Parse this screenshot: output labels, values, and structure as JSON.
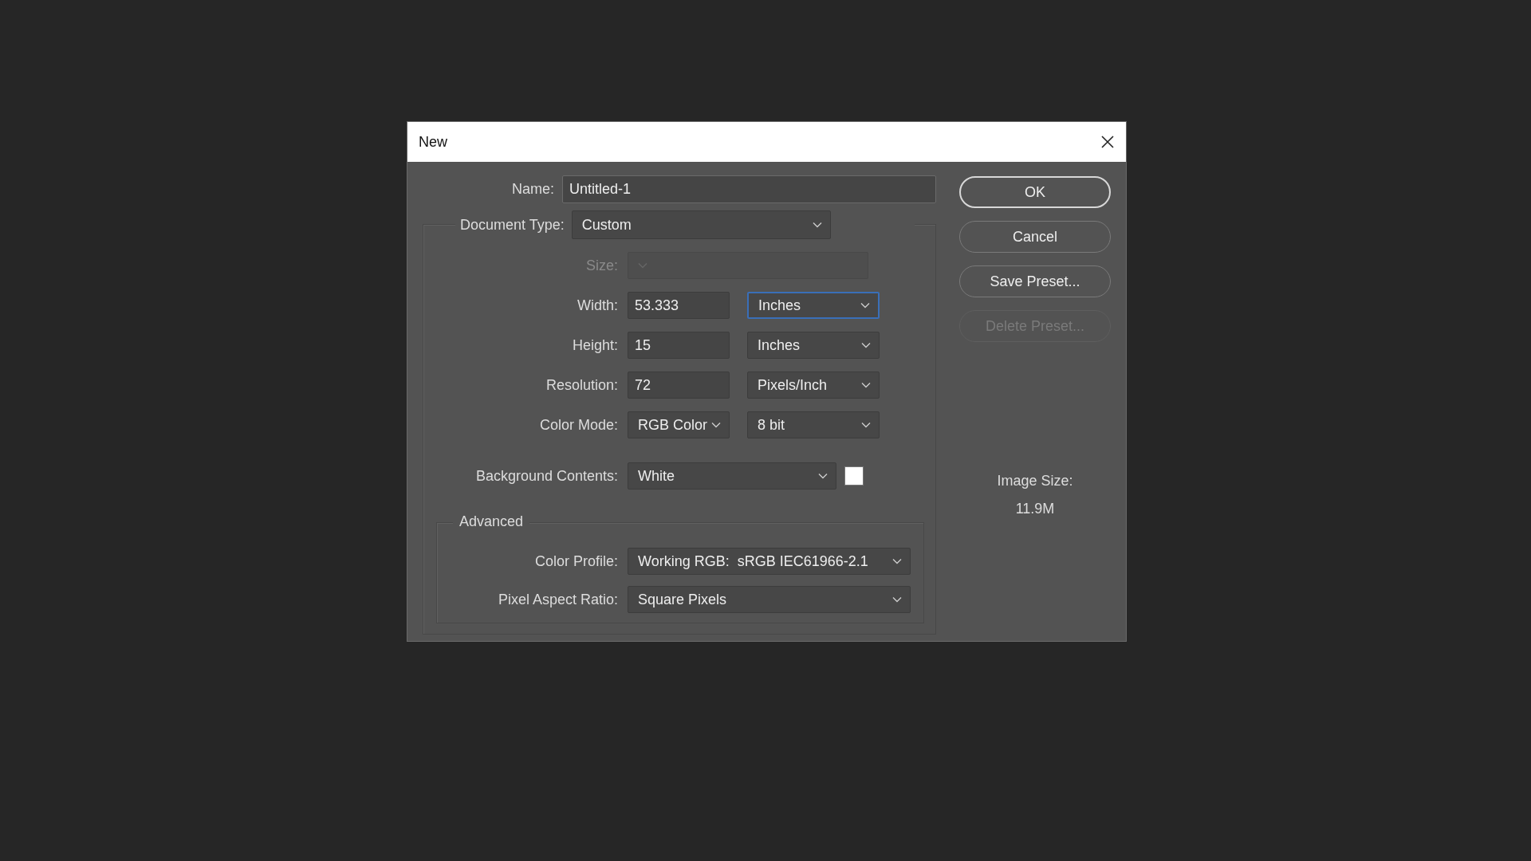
{
  "window": {
    "title": "New"
  },
  "name": {
    "label": "Name:",
    "value": "Untitled-1"
  },
  "document_type": {
    "label": "Document Type:",
    "value": "Custom"
  },
  "fields": [
    {
      "kind": "select",
      "label": "Size:",
      "disabled": true,
      "focused": false
    },
    {
      "kind": "number_unit",
      "label": "Width:",
      "value": "53.333",
      "unit": "Inches",
      "disabled": false,
      "focused": true
    },
    {
      "kind": "number_unit",
      "label": "Height:",
      "value": "15",
      "unit": "Inches",
      "disabled": false,
      "focused": false
    },
    {
      "kind": "number_unit",
      "label": "Resolution:",
      "value": "72",
      "unit": "Pixels/Inch",
      "disabled": false,
      "focused": false
    },
    {
      "kind": "two_selects",
      "label": "Color Mode:",
      "value": "RGB Color",
      "unit": "8 bit",
      "disabled": false,
      "focused": false
    }
  ],
  "background_contents": {
    "label": "Background Contents:",
    "value": "White"
  },
  "advanced": {
    "legend": "Advanced",
    "fields": [
      {
        "label": "Color Profile:",
        "value": "Working RGB:  sRGB IEC61966-2.1"
      },
      {
        "label": "Pixel Aspect Ratio:",
        "value": "Square Pixels"
      }
    ]
  },
  "buttons": [
    {
      "label": "OK",
      "default": true,
      "disabled": false
    },
    {
      "label": "Cancel",
      "default": false,
      "disabled": false
    },
    {
      "label": "Save Preset...",
      "default": false,
      "disabled": false
    },
    {
      "label": "Delete Preset...",
      "default": false,
      "disabled": true
    }
  ],
  "image_size": {
    "label": "Image Size:",
    "value": "11.9M"
  }
}
